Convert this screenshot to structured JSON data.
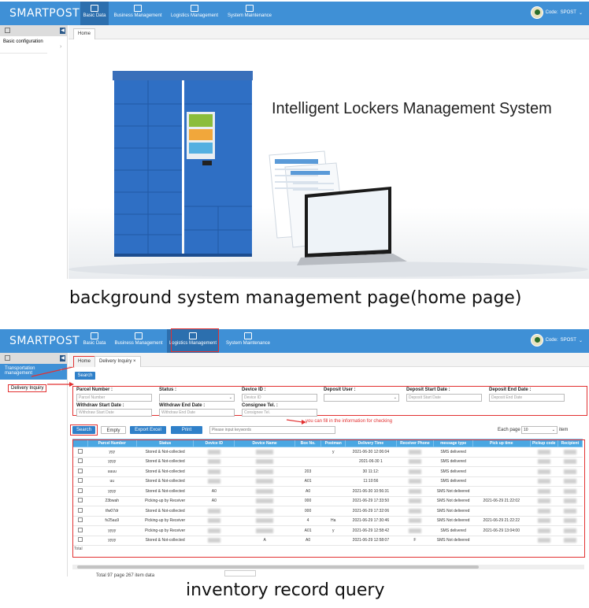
{
  "top": {
    "brand": "SMARTPOST",
    "nav": [
      "Basic Data",
      "Business Management",
      "Logistics Management",
      "System Maintenance"
    ],
    "user_label": "Code:",
    "user_code": "SPOST",
    "sidebar_item": "Basic configuration",
    "tab": "Home",
    "hero_title": "Intelligent Lockers Management System",
    "caption": "background system management page(home page)"
  },
  "bottom": {
    "brand": "SMARTPOST",
    "nav": [
      "Basic Data",
      "Business Management",
      "Logistics Management",
      "System Maintenance"
    ],
    "user_label": "Code:",
    "user_code": "SPOST",
    "sidebar_item": "Transportation management",
    "sidebar_sub": "Delivery Inquiry",
    "tabs": [
      "Home",
      "Delivery Inquiry ×"
    ],
    "search_top": "Search",
    "form": {
      "labels": [
        "Parcel Number :",
        "Status :",
        "Device ID :",
        "Deposit User :",
        "Deposit Start Date :",
        "Deposit End Date :",
        "Withdraw Start Date :",
        "Withdraw End Date :",
        "Consignee Tel. :"
      ],
      "placeholders": [
        "Parcel Number",
        "",
        "Device ID",
        "",
        "Deposit Start Date",
        "Deposit End Date",
        "Withdraw Start Date",
        "Withdraw End Date",
        "Consignee Tel."
      ]
    },
    "hint": "you can fill in the information for checking",
    "actions": [
      "Search",
      "Empty",
      "Export Excel",
      "Print"
    ],
    "keywords_placeholder": "Please input keywords",
    "each_page_label": "Each page",
    "each_page_value": "10",
    "item_label": "item",
    "columns": [
      "",
      "Parcel Number",
      "Status",
      "Device ID",
      "Device Name",
      "Box No.",
      "Postman",
      "Delivery Time",
      "Receiver Phone",
      "message type",
      "Pick up time",
      "Pickup code",
      "Recipient"
    ],
    "rows": [
      [
        "yyy",
        "Stored & Not-collected",
        "",
        "",
        "",
        "y",
        "2021-06-30 12:06:04",
        "",
        "SMS delivered",
        ""
      ],
      [
        "yyyy",
        "Stored & Not-collected",
        "",
        "",
        "",
        "",
        "2021-06-30 1",
        "",
        "SMS delivered",
        ""
      ],
      [
        "uuuu",
        "Stored & Not-collected",
        "",
        "",
        "203",
        "",
        "30 11:12:",
        "",
        "SMS delivered",
        ""
      ],
      [
        "uu",
        "Stored & Not-collected",
        "",
        "",
        "A01",
        "",
        "11:10:56",
        "",
        "SMS delivered",
        ""
      ],
      [
        "yyyy",
        "Stored & Not-collected",
        "A0",
        "",
        "A0",
        "",
        "2021-06-30 10:56:31",
        "",
        "SMS Not delivered",
        ""
      ],
      [
        "23bwah",
        "Picking-up by Receiver",
        "A0",
        "",
        "000",
        "",
        "2021-06-29 17:33:50",
        "",
        "SMS Not delivered",
        "2021-06-29 21:22:02"
      ],
      [
        "tfw07dr",
        "Stored & Not-collected",
        "",
        "",
        "000",
        "",
        "2021-06-29 17:32:06",
        "",
        "SMS Not delivered",
        ""
      ],
      [
        "fv25au9",
        "Picking-up by Receiver",
        "",
        "",
        "4",
        "Ha",
        "2021-06-29 17:30:46",
        "",
        "SMS Not delivered",
        "2021-06-29 21:22:22"
      ],
      [
        "yyyy",
        "Picking-up by Receiver",
        "",
        "",
        "A01",
        "y",
        "2021-06-29 12:58:42",
        "",
        "SMS delivered",
        "2021-06-29 13:04:00"
      ],
      [
        "yyyy",
        "Stored & Not-collected",
        "",
        "A",
        "A0",
        "",
        "2021-06-29 12:58:07",
        "F",
        "SMS Not delivered",
        ""
      ]
    ],
    "total_label": "Total",
    "footer": "Total 97 page 267 item data",
    "caption": "inventory record query"
  },
  "colors": {
    "bar": "#3f90d6",
    "active": "#2c6fae",
    "header": "#4aa7e2",
    "highlight": "#e23131"
  }
}
